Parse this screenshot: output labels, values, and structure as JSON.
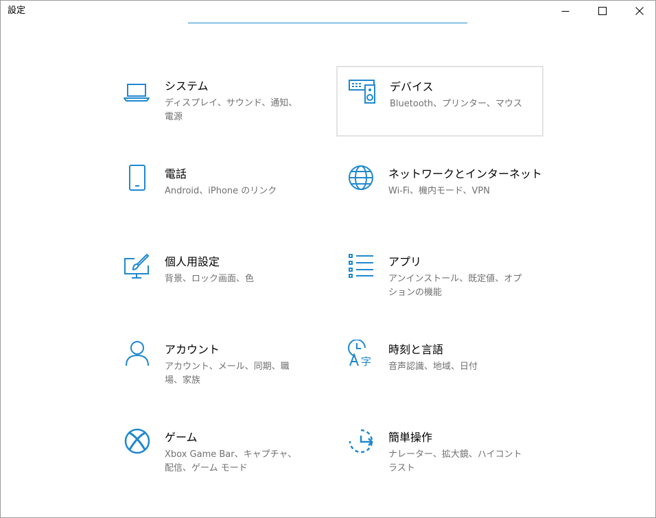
{
  "window": {
    "title": "設定"
  },
  "accent_color": "#1e88cf",
  "tiles": [
    {
      "title": "システム",
      "desc": "ディスプレイ、サウンド、通知、電源",
      "icon": "laptop-icon"
    },
    {
      "title": "デバイス",
      "desc": "Bluetooth、プリンター、マウス",
      "icon": "keyboard-speaker-icon"
    },
    {
      "title": "電話",
      "desc": "Android、iPhone のリンク",
      "icon": "phone-icon"
    },
    {
      "title": "ネットワークとインターネット",
      "desc": "Wi-Fi、機内モード、VPN",
      "icon": "globe-icon"
    },
    {
      "title": "個人用設定",
      "desc": "背景、ロック画面、色",
      "icon": "paintbrush-monitor-icon"
    },
    {
      "title": "アプリ",
      "desc": "アンインストール、既定値、オプションの機能",
      "icon": "app-list-icon"
    },
    {
      "title": "アカウント",
      "desc": "アカウント、メール、同期、職場、家族",
      "icon": "person-icon"
    },
    {
      "title": "時刻と言語",
      "desc": "音声認識、地域、日付",
      "icon": "time-language-icon"
    },
    {
      "title": "ゲーム",
      "desc": "Xbox Game Bar、キャプチャ、配信、ゲーム モード",
      "icon": "xbox-icon"
    },
    {
      "title": "簡単操作",
      "desc": "ナレーター、拡大鏡、ハイコントラスト",
      "icon": "ease-of-access-icon"
    }
  ]
}
